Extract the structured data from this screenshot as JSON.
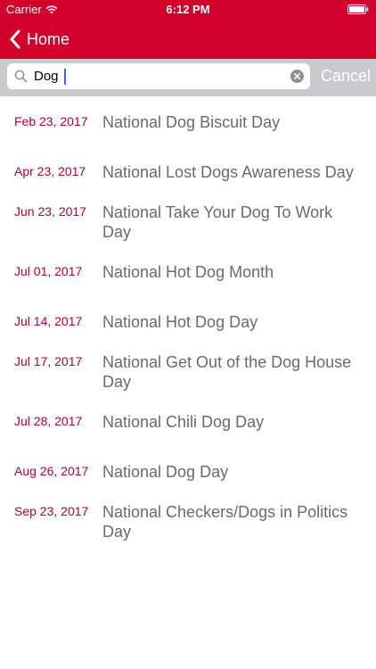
{
  "status_bar": {
    "carrier": "Carrier",
    "time": "6:12 PM",
    "wifi_icon": "wifi-icon",
    "battery_icon": "battery-icon"
  },
  "nav": {
    "back_label": "Home",
    "back_icon": "chevron-left-icon"
  },
  "search": {
    "value": "Dog",
    "placeholder": "",
    "cancel_label": "Cancel",
    "search_icon": "search-icon",
    "clear_icon": "clear-icon"
  },
  "results": [
    {
      "date": "Feb 23, 2017",
      "title": "National Dog Biscuit Day"
    },
    {
      "date": "Apr 23, 2017",
      "title": "National Lost Dogs Awareness Day"
    },
    {
      "date": "Jun 23, 2017",
      "title": "National Take Your Dog To Work Day"
    },
    {
      "date": "Jul 01, 2017",
      "title": "National Hot Dog Month"
    },
    {
      "date": "Jul 14, 2017",
      "title": "National Hot Dog Day"
    },
    {
      "date": "Jul 17, 2017",
      "title": "National Get Out of the Dog House Day"
    },
    {
      "date": "Jul 28, 2017",
      "title": "National Chili Dog Day"
    },
    {
      "date": "Aug 26, 2017",
      "title": "National Dog Day"
    },
    {
      "date": "Sep 23, 2017",
      "title": "National Checkers/Dogs in Politics Day"
    }
  ],
  "colors": {
    "accent": "#d4002c",
    "date_text": "#b8002a",
    "title_text": "#6a6a6a",
    "search_bar_bg": "#c9c9ce"
  }
}
